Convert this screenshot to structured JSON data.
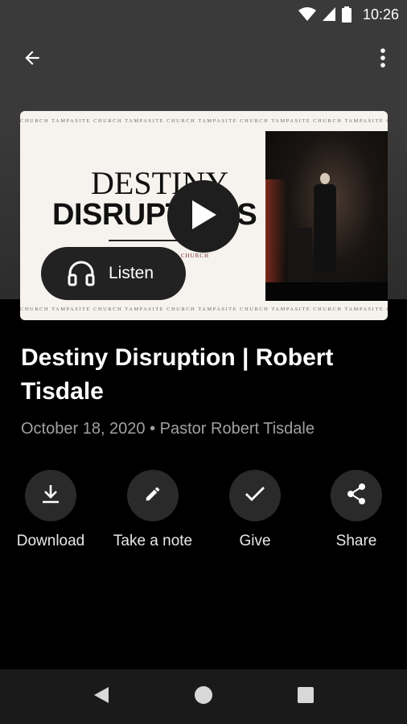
{
  "status_bar": {
    "time": "10:26",
    "icons": [
      "wifi-icon",
      "signal-icon",
      "battery-icon"
    ]
  },
  "app_bar": {
    "back_icon": "arrow-left-icon",
    "more_icon": "more-vertical-icon"
  },
  "artwork": {
    "strip_text": "CHURCH TAMPASITE CHURCH TAMPASITE CHURCH TAMPASITE CHURCH TAMPASITE CHURCH TAMPASITE CHURCH",
    "title_line_1": "DESTINY",
    "title_line_2": "DISRUPTIONS",
    "sub_text": "TAMPASITE CHURCH"
  },
  "player": {
    "play_icon": "play-icon",
    "listen_label": "Listen",
    "listen_icon": "headphones-icon"
  },
  "sermon": {
    "title": "Destiny Disruption | Robert Tisdale",
    "meta": "October 18, 2020 • Pastor Robert Tisdale"
  },
  "actions": [
    {
      "label": "Download",
      "icon": "download-icon"
    },
    {
      "label": "Take a note",
      "icon": "pencil-icon"
    },
    {
      "label": "Give",
      "icon": "check-icon"
    },
    {
      "label": "Share",
      "icon": "share-icon"
    }
  ],
  "nav_bar": {
    "back": "nav-back-icon",
    "home": "nav-home-icon",
    "recents": "nav-recents-icon"
  },
  "colors": {
    "background": "#000000",
    "header_gray": "#3a3a3a",
    "action_circle": "#2a2a2a",
    "meta_text": "#a0a0a0"
  }
}
